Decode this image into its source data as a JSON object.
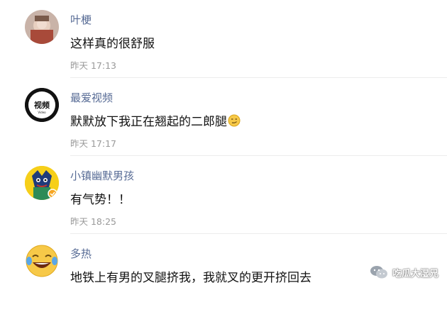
{
  "comments": [
    {
      "username": "叶梗",
      "content": "这样真的很舒服",
      "time": "昨天 17:13"
    },
    {
      "username": "最爱视频",
      "content": "默默放下我正在翘起的二郎腿",
      "time": "昨天 17:17",
      "avatar_text": "视频",
      "avatar_subtext": "Video"
    },
    {
      "username": "小镇幽默男孩",
      "content": "有气势！！",
      "time": "昨天 18:25"
    },
    {
      "username": "多热",
      "content": "地铁上有男的叉腿挤我，我就叉的更开挤回去"
    }
  ],
  "watermark": {
    "text": "吃瓜大湿兄"
  },
  "colors": {
    "username": "#576b95",
    "time": "#999999",
    "divider": "#ececec"
  }
}
